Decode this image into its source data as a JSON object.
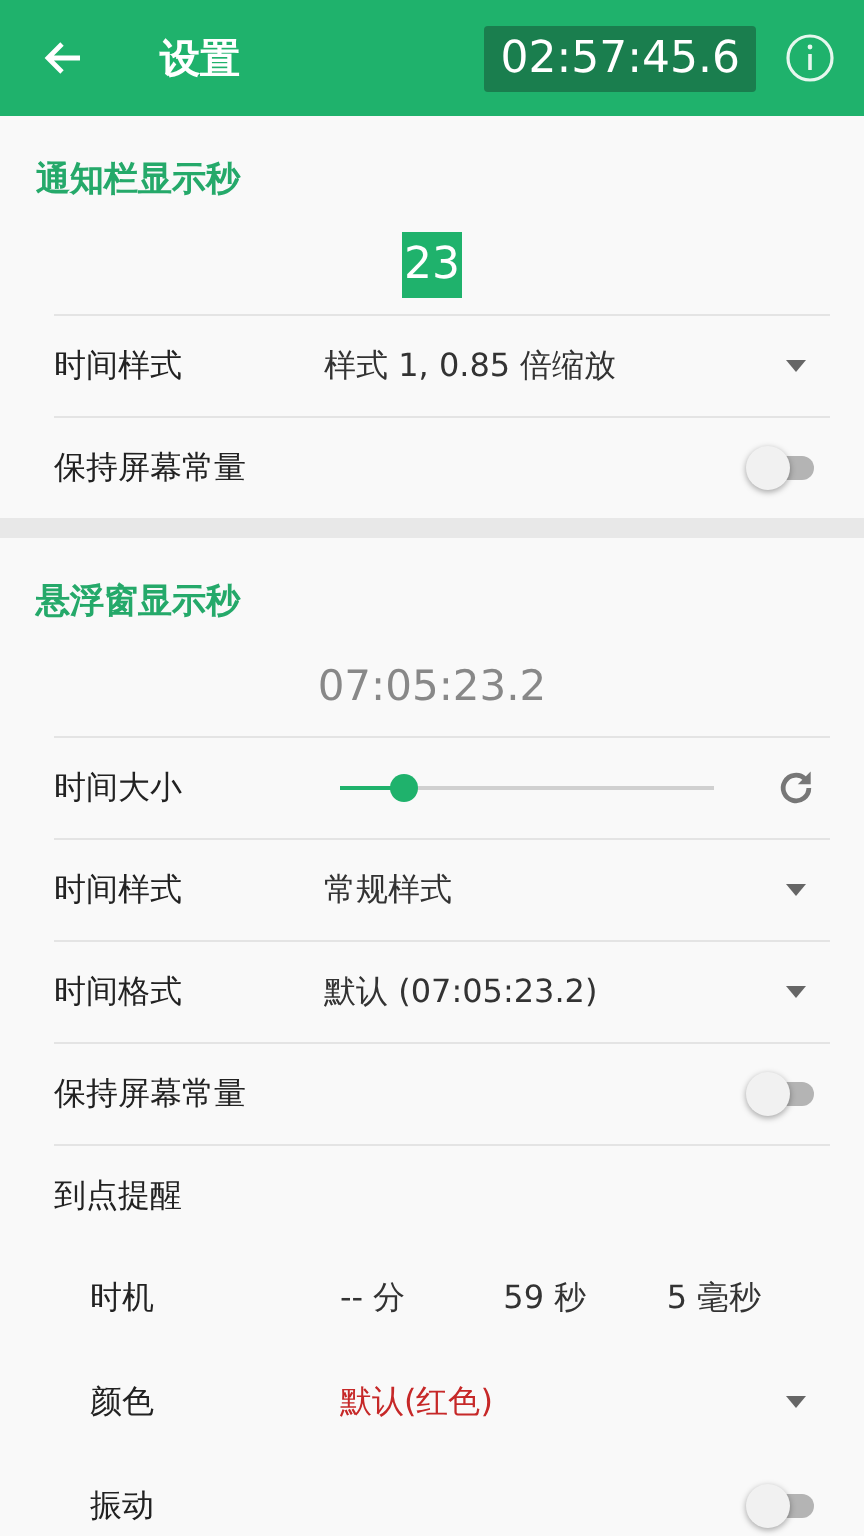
{
  "header": {
    "title": "设置",
    "clock": "02:57:45.6"
  },
  "sections": [
    {
      "title": "通知栏显示秒",
      "preview": {
        "kind": "badge",
        "text": "23"
      },
      "rows": [
        {
          "kind": "dropdown",
          "label": "时间样式",
          "value": "样式 1, 0.85 倍缩放"
        },
        {
          "kind": "switch",
          "label": "保持屏幕常量",
          "on": false
        }
      ]
    },
    {
      "title": "悬浮窗显示秒",
      "preview": {
        "kind": "plain",
        "text": "07:05:23.2"
      },
      "rows": [
        {
          "kind": "slider",
          "label": "时间大小",
          "level": 0.17
        },
        {
          "kind": "dropdown",
          "label": "时间样式",
          "value": "常规样式"
        },
        {
          "kind": "dropdown",
          "label": "时间格式",
          "value": "默认 (07:05:23.2)"
        },
        {
          "kind": "switch",
          "label": "保持屏幕常量",
          "on": false
        },
        {
          "kind": "group",
          "label": "到点提醒",
          "children": [
            {
              "kind": "timing",
              "label": "时机",
              "values": [
                "-- 分",
                "59 秒",
                "5 毫秒"
              ]
            },
            {
              "kind": "dropdown",
              "label": "颜色",
              "value": "默认(红色)",
              "color": "#c62828"
            },
            {
              "kind": "switch",
              "label": "振动",
              "on": false
            }
          ]
        }
      ]
    }
  ]
}
